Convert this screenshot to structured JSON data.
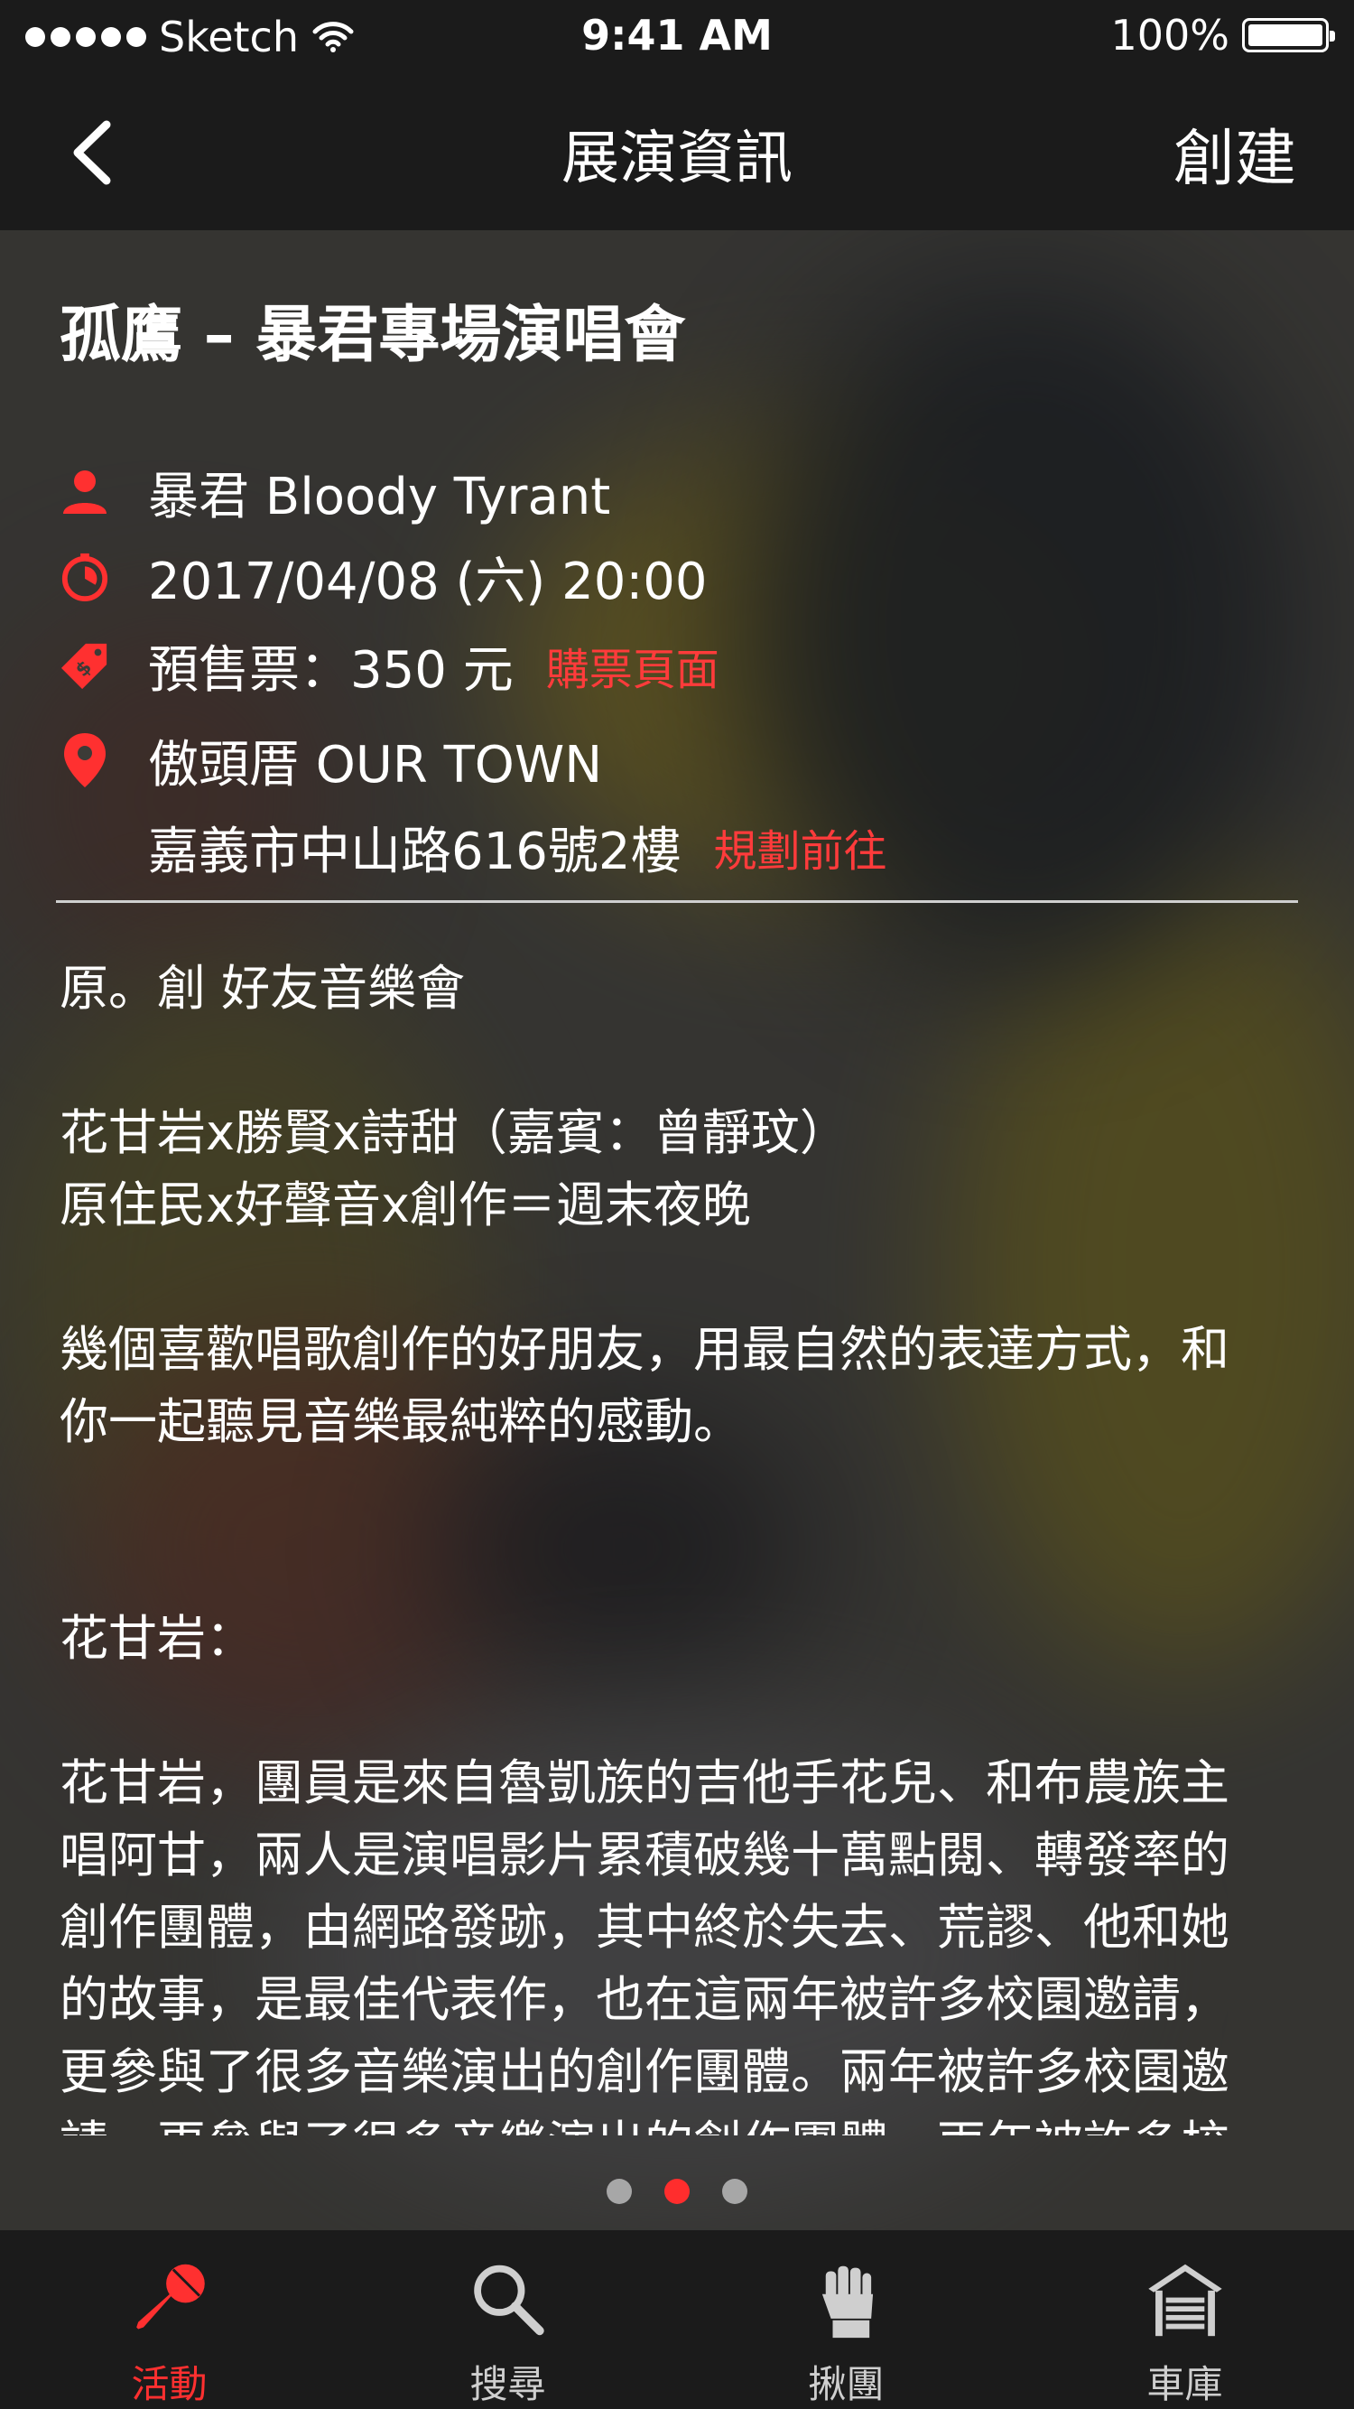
{
  "status_bar": {
    "carrier": "Sketch",
    "time": "9:41 AM",
    "battery": "100%"
  },
  "nav": {
    "title": "展演資訊",
    "action_label": "創建"
  },
  "event": {
    "title": "孤鷹 – 暴君專場演唱會",
    "performer": "暴君 Bloody Tyrant",
    "datetime": "2017/04/08 (六) 20:00",
    "ticket": "預售票：350 元",
    "ticket_link": "購票頁面",
    "venue": "傲頭厝 OUR TOWN",
    "address": "嘉義市中山路616號2樓",
    "directions_link": "規劃前往"
  },
  "description": "原。創 好友音樂會\n\n花甘岩x勝賢x詩甜（嘉賓：曾靜玟）\n原住民x好聲音x創作＝週末夜晚\n\n幾個喜歡唱歌創作的好朋友，用最自然的表達方式，和\n你一起聽見音樂最純粹的感動。\n\n\n花甘岩：\n\n花甘岩，團員是來自魯凱族的吉他手花兒、和布農族主\n唱阿甘，兩人是演唱影片累積破幾十萬點閱、轉發率的\n創作團體，由網路發跡，其中終於失去、荒謬、他和她\n的故事，是最佳代表作，也在這兩年被許多校園邀請，\n更參與了很多音樂演出的創作團體。兩年被許多校園邀\n請，更參與了很多音樂演出的創作團體。兩年被許多校",
  "pagination": {
    "count": 3,
    "active_index": 1
  },
  "tabs": [
    {
      "label": "活動",
      "icon": "microphone-icon",
      "active": true
    },
    {
      "label": "搜尋",
      "icon": "search-icon",
      "active": false
    },
    {
      "label": "揪團",
      "icon": "fist-icon",
      "active": false
    },
    {
      "label": "車庫",
      "icon": "garage-icon",
      "active": false
    }
  ],
  "colors": {
    "accent": "#ff3030",
    "bar_background": "#1b1b1b",
    "inactive_icon": "#cfcfcf"
  }
}
